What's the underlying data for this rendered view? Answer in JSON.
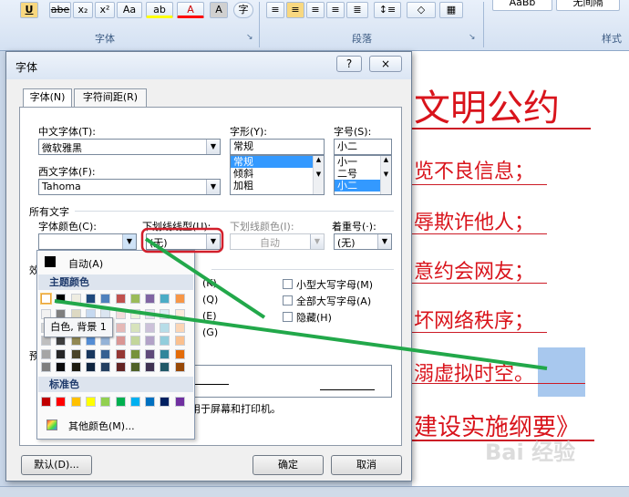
{
  "ribbon": {
    "buttons": [
      "U",
      "abe",
      "x₂",
      "x²",
      "Aa",
      "ab",
      "A",
      "A",
      "字"
    ],
    "groups": [
      "字体",
      "段落",
      "样式"
    ],
    "styles_partial": [
      "AaBb",
      "无间隔"
    ]
  },
  "dialog": {
    "title": "字体",
    "help": "?",
    "close": "×",
    "tabs": [
      "字体(N)",
      "字符间距(R)"
    ],
    "chinese_font_label": "中文字体(T):",
    "chinese_font_value": "微软雅黑",
    "western_font_label": "西文字体(F):",
    "western_font_value": "Tahoma",
    "style_label": "字形(Y):",
    "style_value": "常规",
    "style_options": [
      "常规",
      "倾斜",
      "加粗"
    ],
    "size_label": "字号(S):",
    "size_value": "小二",
    "size_options": [
      "小一",
      "二号",
      "小二"
    ],
    "all_text_label": "所有文字",
    "font_color_label": "字体颜色(C):",
    "underline_type_label": "下划线线型(U):",
    "underline_type_value": "(无)",
    "underline_color_label": "下划线颜色(I):",
    "underline_color_value": "自动",
    "emphasis_label": "着重号(·):",
    "emphasis_value": "(无)",
    "effects_label": "效",
    "effects": [
      "小型大写字母(M)",
      "全部大写字母(A)",
      "隐藏(H)"
    ],
    "effects_left_hotkeys": [
      "(K)",
      "(Q)",
      "(E)",
      "(G)"
    ],
    "preview_label": "预",
    "preview_note": "适用于屏幕和打印机。",
    "default_button": "默认(D)...",
    "ok_button": "确定",
    "cancel_button": "取消"
  },
  "color_popup": {
    "auto_label": "自动(A)",
    "theme_label": "主题颜色",
    "standard_label": "标准色",
    "more_label": "其他颜色(M)...",
    "theme_top": [
      "#ffffff",
      "#000000",
      "#eeece1",
      "#1f497d",
      "#4f81bd",
      "#c0504d",
      "#9bbb59",
      "#8064a2",
      "#4bacc6",
      "#f79646"
    ],
    "theme_columns": [
      [
        "#f2f2f2",
        "#d8d8d8",
        "#bfbfbf",
        "#a5a5a5",
        "#7f7f7f"
      ],
      [
        "#7f7f7f",
        "#595959",
        "#3f3f3f",
        "#262626",
        "#0c0c0c"
      ],
      [
        "#ddd9c3",
        "#c4bd97",
        "#938953",
        "#494429",
        "#1d1b10"
      ],
      [
        "#c6d9f0",
        "#8db3e2",
        "#548dd4",
        "#17365d",
        "#0f243e"
      ],
      [
        "#dbe5f1",
        "#b8cce4",
        "#95b3d7",
        "#366092",
        "#244061"
      ],
      [
        "#f2dcdb",
        "#e5b9b7",
        "#d99694",
        "#953734",
        "#632423"
      ],
      [
        "#ebf1dd",
        "#d7e3bc",
        "#c3d69b",
        "#76923c",
        "#4f6128"
      ],
      [
        "#e5e0ec",
        "#ccc1d9",
        "#b2a2c7",
        "#5f497a",
        "#3f3151"
      ],
      [
        "#dbeef3",
        "#b7dde8",
        "#92cddc",
        "#31859b",
        "#205867"
      ],
      [
        "#fdeada",
        "#fbd5b5",
        "#fac08f",
        "#e36c09",
        "#974806"
      ]
    ],
    "standard": [
      "#c00000",
      "#ff0000",
      "#ffc000",
      "#ffff00",
      "#92d050",
      "#00b050",
      "#00b0f0",
      "#0070c0",
      "#002060",
      "#7030a0"
    ],
    "tooltip": "白色, 背景 1"
  },
  "document": {
    "lines": [
      "文明公约",
      "览不良信息；",
      "辱欺诈他人；",
      "意约会网友；",
      "坏网络秩序；",
      "溺虚拟时空。",
      "建设实施纲要》"
    ],
    "text_color": "#d9141c",
    "watermark": "Bai 经验"
  },
  "annotation_color": "#22a84a",
  "highlight_color": "#d21f2b"
}
